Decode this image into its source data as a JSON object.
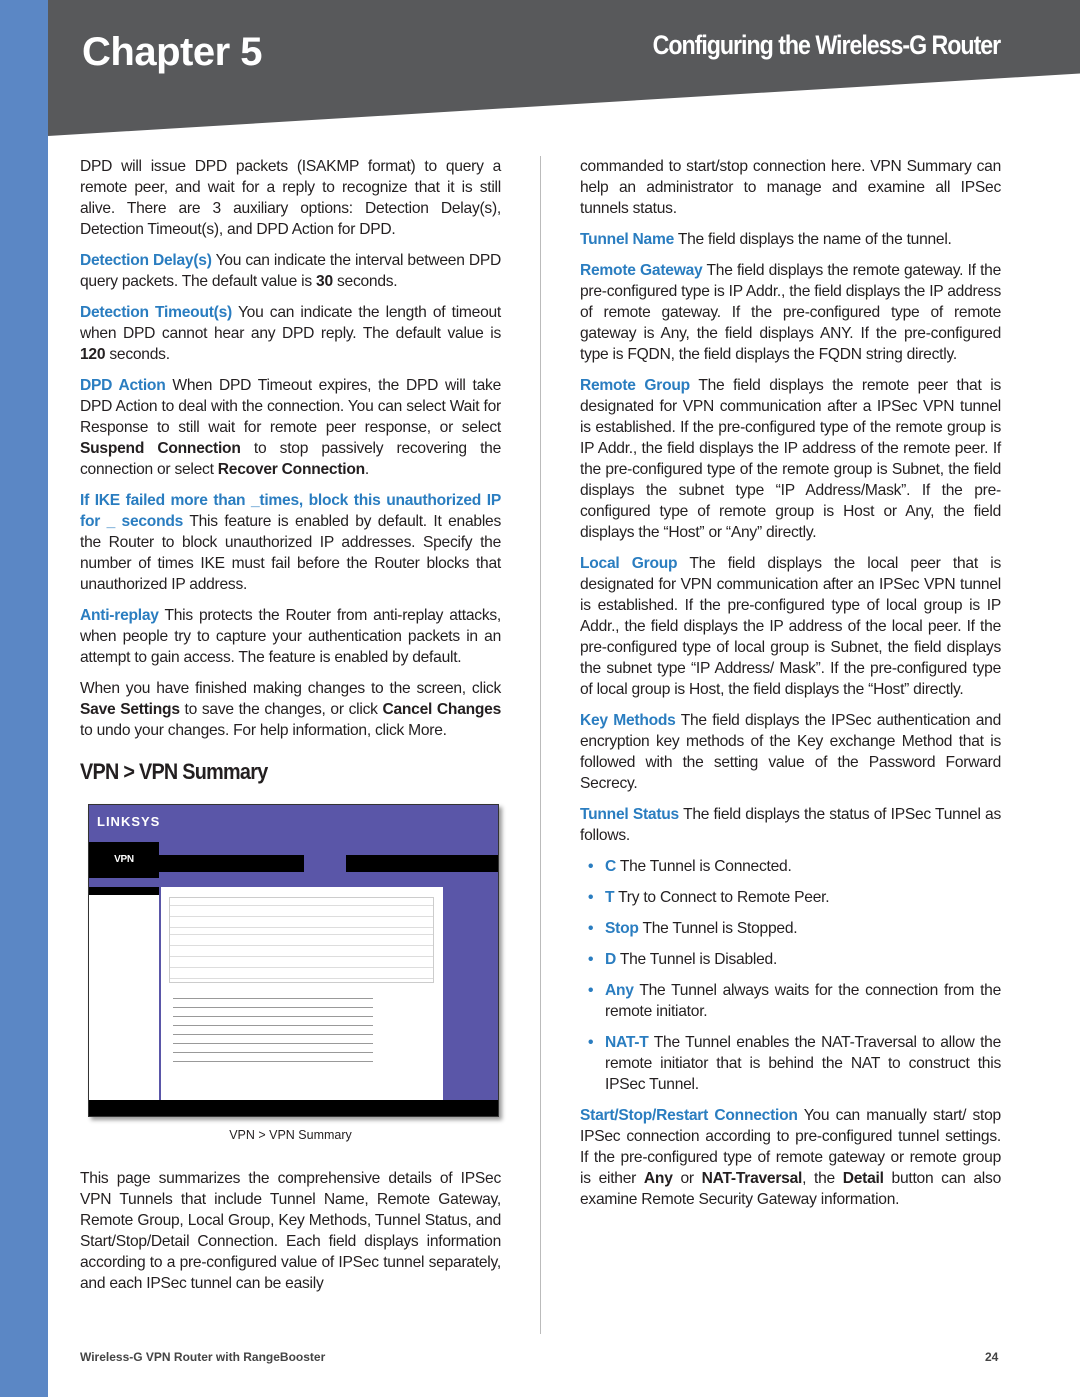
{
  "header": {
    "chapter": "Chapter 5",
    "title": "Configuring the Wireless-G Router"
  },
  "colors": {
    "accent": "#2a7dc0",
    "strip": "#5b87c5",
    "header": "#58595b"
  },
  "left": [
    [
      {
        "t": "DPD will issue DPD packets (ISAKMP format) to query a remote peer, and wait for a reply to recognize that it is still alive. There are 3 auxiliary options: Detection Delay(s), Detection Timeout(s), and DPD Action for DPD."
      }
    ],
    [
      {
        "t": "Detection Delay(s)",
        "s": "h"
      },
      {
        "t": "  You can indicate the interval between DPD query packets. The default value is "
      },
      {
        "t": "30",
        "s": "b"
      },
      {
        "t": " seconds."
      }
    ],
    [
      {
        "t": "Detection Timeout(s)",
        "s": "h"
      },
      {
        "t": "  You can indicate the length of timeout when DPD cannot hear any DPD reply. The default value is "
      },
      {
        "t": "120",
        "s": "b"
      },
      {
        "t": " seconds."
      }
    ],
    [
      {
        "t": "DPD Action",
        "s": "h"
      },
      {
        "t": "  When DPD Timeout expires, the DPD will take DPD Action to deal with the connection. You can select Wait for Response to still wait for remote peer response, or select "
      },
      {
        "t": "Suspend Connection",
        "s": "b"
      },
      {
        "t": " to stop passively recovering the connection or select "
      },
      {
        "t": "Recover Connection",
        "s": "b"
      },
      {
        "t": "."
      }
    ],
    [
      {
        "t": "If IKE failed more than _times, block this unauthorized IP for _ seconds",
        "s": "h"
      },
      {
        "t": "  This feature is enabled by default. It enables the Router to block unauthorized IP addresses. Specify the number of times IKE must fail before the Router blocks that unauthorized IP address."
      }
    ],
    [
      {
        "t": "Anti-replay",
        "s": "h"
      },
      {
        "t": "  This protects the Router from anti-replay attacks, when people try to capture your authentication packets in an attempt to gain access. The feature is enabled by default."
      }
    ],
    [
      {
        "t": "When you have finished making changes to the screen, click "
      },
      {
        "t": "Save Settings",
        "s": "b"
      },
      {
        "t": " to save the changes, or click "
      },
      {
        "t": "Cancel Changes",
        "s": "b"
      },
      {
        "t": " to undo your changes. For help information, click More."
      }
    ]
  ],
  "section_title": "VPN > VPN Summary",
  "figure": {
    "logo": "LINKSYS",
    "tab": "VPN",
    "caption": "VPN > VPN Summary"
  },
  "left_after": [
    [
      {
        "t": "This page summarizes the comprehensive details of IPSec VPN Tunnels that include Tunnel Name, Remote Gateway, Remote Group, Local Group, Key Methods, Tunnel Status, and Start/Stop/Detail Connection. Each field displays information according to a pre-configured value of IPSec tunnel separately, and each IPSec tunnel can be easily"
      }
    ]
  ],
  "right": [
    [
      {
        "t": "commanded to start/stop connection here. VPN Summary can help an administrator to manage and examine all IPSec tunnels status."
      }
    ],
    [
      {
        "t": "Tunnel Name",
        "s": "h"
      },
      {
        "t": "  The field displays the name of the tunnel."
      }
    ],
    [
      {
        "t": "Remote Gateway",
        "s": "h"
      },
      {
        "t": "  The field displays the remote gateway. If the pre-configured type is IP Addr., the field displays the IP address of remote gateway. If the pre-configured type of remote gateway is Any, the field displays ANY. If the pre-configured type is FQDN, the field displays the FQDN string directly."
      }
    ],
    [
      {
        "t": "Remote Group",
        "s": "h"
      },
      {
        "t": "  The field displays the remote peer that is designated for VPN communication after a IPSec VPN tunnel is established. If the pre-configured type of the remote group is IP Addr., the field displays the IP address of the remote peer. If the pre-configured type of the remote group is Subnet, the field displays the subnet type “IP Address/Mask”. If the pre-configured type of remote group is Host or Any, the field displays the “Host” or “Any” directly."
      }
    ],
    [
      {
        "t": "Local Group",
        "s": "h"
      },
      {
        "t": "  The field displays the local peer that is designated for VPN communication after an IPSec VPN tunnel is established. If the pre-configured type of local group is IP Addr., the field displays the IP address of the local peer. If the pre-configured type of local group is Subnet, the field displays the subnet type “IP Address/ Mask”. If the pre-configured type of local group is Host, the field displays the “Host” directly."
      }
    ],
    [
      {
        "t": "Key Methods",
        "s": "h"
      },
      {
        "t": "  The field displays the IPSec authentication and encryption key methods of the Key exchange Method that is followed with the setting value of the Password Forward Secrecy."
      }
    ],
    [
      {
        "t": "Tunnel Status",
        "s": "h"
      },
      {
        "t": "  The field displays the status of IPSec Tunnel as follows."
      }
    ]
  ],
  "bullets": [
    [
      {
        "t": "C",
        "s": "h"
      },
      {
        "t": "  The Tunnel is Connected."
      }
    ],
    [
      {
        "t": "T",
        "s": "h"
      },
      {
        "t": "  Try to Connect to Remote Peer."
      }
    ],
    [
      {
        "t": "Stop",
        "s": "h"
      },
      {
        "t": "  The Tunnel is Stopped."
      }
    ],
    [
      {
        "t": "D",
        "s": "h"
      },
      {
        "t": "  The Tunnel is Disabled."
      }
    ],
    [
      {
        "t": "Any",
        "s": "h"
      },
      {
        "t": "  The Tunnel always waits for the connection from the remote initiator."
      }
    ],
    [
      {
        "t": "NAT-T",
        "s": "h"
      },
      {
        "t": "  The Tunnel enables the NAT-Traversal to allow the remote initiator that is behind the NAT to construct this IPSec Tunnel."
      }
    ]
  ],
  "right_after": [
    [
      {
        "t": "Start/Stop/Restart Connection",
        "s": "h"
      },
      {
        "t": "  You can manually start/ stop IPSec connection according to pre-configured tunnel settings. If the pre-configured type of remote gateway or remote group is either "
      },
      {
        "t": "Any",
        "s": "b"
      },
      {
        "t": " or "
      },
      {
        "t": "NAT-Traversal",
        "s": "b"
      },
      {
        "t": ", the "
      },
      {
        "t": "Detail",
        "s": "b"
      },
      {
        "t": " button can also examine Remote Security Gateway information."
      }
    ]
  ],
  "footer": {
    "product": "Wireless-G VPN Router with RangeBooster",
    "page": "24"
  }
}
